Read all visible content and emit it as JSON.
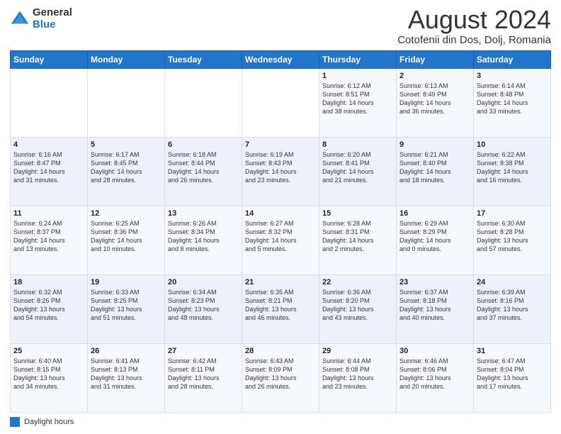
{
  "header": {
    "logo_general": "General",
    "logo_blue": "Blue",
    "month_title": "August 2024",
    "location": "Cotofenii din Dos, Dolj, Romania"
  },
  "weekdays": [
    "Sunday",
    "Monday",
    "Tuesday",
    "Wednesday",
    "Thursday",
    "Friday",
    "Saturday"
  ],
  "weeks": [
    [
      {
        "day": "",
        "info": ""
      },
      {
        "day": "",
        "info": ""
      },
      {
        "day": "",
        "info": ""
      },
      {
        "day": "",
        "info": ""
      },
      {
        "day": "1",
        "info": "Sunrise: 6:12 AM\nSunset: 8:51 PM\nDaylight: 14 hours\nand 38 minutes."
      },
      {
        "day": "2",
        "info": "Sunrise: 6:13 AM\nSunset: 8:49 PM\nDaylight: 14 hours\nand 36 minutes."
      },
      {
        "day": "3",
        "info": "Sunrise: 6:14 AM\nSunset: 8:48 PM\nDaylight: 14 hours\nand 33 minutes."
      }
    ],
    [
      {
        "day": "4",
        "info": "Sunrise: 6:16 AM\nSunset: 8:47 PM\nDaylight: 14 hours\nand 31 minutes."
      },
      {
        "day": "5",
        "info": "Sunrise: 6:17 AM\nSunset: 8:45 PM\nDaylight: 14 hours\nand 28 minutes."
      },
      {
        "day": "6",
        "info": "Sunrise: 6:18 AM\nSunset: 8:44 PM\nDaylight: 14 hours\nand 26 minutes."
      },
      {
        "day": "7",
        "info": "Sunrise: 6:19 AM\nSunset: 8:43 PM\nDaylight: 14 hours\nand 23 minutes."
      },
      {
        "day": "8",
        "info": "Sunrise: 6:20 AM\nSunset: 8:41 PM\nDaylight: 14 hours\nand 21 minutes."
      },
      {
        "day": "9",
        "info": "Sunrise: 6:21 AM\nSunset: 8:40 PM\nDaylight: 14 hours\nand 18 minutes."
      },
      {
        "day": "10",
        "info": "Sunrise: 6:22 AM\nSunset: 8:38 PM\nDaylight: 14 hours\nand 16 minutes."
      }
    ],
    [
      {
        "day": "11",
        "info": "Sunrise: 6:24 AM\nSunset: 8:37 PM\nDaylight: 14 hours\nand 13 minutes."
      },
      {
        "day": "12",
        "info": "Sunrise: 6:25 AM\nSunset: 8:36 PM\nDaylight: 14 hours\nand 10 minutes."
      },
      {
        "day": "13",
        "info": "Sunrise: 6:26 AM\nSunset: 8:34 PM\nDaylight: 14 hours\nand 8 minutes."
      },
      {
        "day": "14",
        "info": "Sunrise: 6:27 AM\nSunset: 8:32 PM\nDaylight: 14 hours\nand 5 minutes."
      },
      {
        "day": "15",
        "info": "Sunrise: 6:28 AM\nSunset: 8:31 PM\nDaylight: 14 hours\nand 2 minutes."
      },
      {
        "day": "16",
        "info": "Sunrise: 6:29 AM\nSunset: 8:29 PM\nDaylight: 14 hours\nand 0 minutes."
      },
      {
        "day": "17",
        "info": "Sunrise: 6:30 AM\nSunset: 8:28 PM\nDaylight: 13 hours\nand 57 minutes."
      }
    ],
    [
      {
        "day": "18",
        "info": "Sunrise: 6:32 AM\nSunset: 8:26 PM\nDaylight: 13 hours\nand 54 minutes."
      },
      {
        "day": "19",
        "info": "Sunrise: 6:33 AM\nSunset: 8:25 PM\nDaylight: 13 hours\nand 51 minutes."
      },
      {
        "day": "20",
        "info": "Sunrise: 6:34 AM\nSunset: 8:23 PM\nDaylight: 13 hours\nand 48 minutes."
      },
      {
        "day": "21",
        "info": "Sunrise: 6:35 AM\nSunset: 8:21 PM\nDaylight: 13 hours\nand 46 minutes."
      },
      {
        "day": "22",
        "info": "Sunrise: 6:36 AM\nSunset: 8:20 PM\nDaylight: 13 hours\nand 43 minutes."
      },
      {
        "day": "23",
        "info": "Sunrise: 6:37 AM\nSunset: 8:18 PM\nDaylight: 13 hours\nand 40 minutes."
      },
      {
        "day": "24",
        "info": "Sunrise: 6:39 AM\nSunset: 8:16 PM\nDaylight: 13 hours\nand 37 minutes."
      }
    ],
    [
      {
        "day": "25",
        "info": "Sunrise: 6:40 AM\nSunset: 8:15 PM\nDaylight: 13 hours\nand 34 minutes."
      },
      {
        "day": "26",
        "info": "Sunrise: 6:41 AM\nSunset: 8:13 PM\nDaylight: 13 hours\nand 31 minutes."
      },
      {
        "day": "27",
        "info": "Sunrise: 6:42 AM\nSunset: 8:11 PM\nDaylight: 13 hours\nand 28 minutes."
      },
      {
        "day": "28",
        "info": "Sunrise: 6:43 AM\nSunset: 8:09 PM\nDaylight: 13 hours\nand 26 minutes."
      },
      {
        "day": "29",
        "info": "Sunrise: 6:44 AM\nSunset: 8:08 PM\nDaylight: 13 hours\nand 23 minutes."
      },
      {
        "day": "30",
        "info": "Sunrise: 6:46 AM\nSunset: 8:06 PM\nDaylight: 13 hours\nand 20 minutes."
      },
      {
        "day": "31",
        "info": "Sunrise: 6:47 AM\nSunset: 8:04 PM\nDaylight: 13 hours\nand 17 minutes."
      }
    ]
  ],
  "footer": {
    "legend_label": "Daylight hours"
  }
}
